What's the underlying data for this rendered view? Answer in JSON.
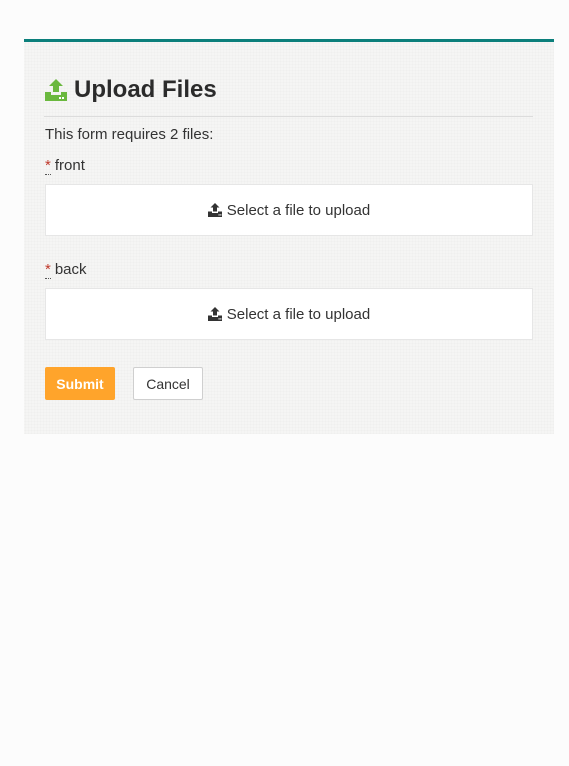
{
  "header": {
    "title": "Upload Files",
    "icon": "upload-icon",
    "icon_color": "#6ab83e"
  },
  "form": {
    "intro": "This form requires 2 files:",
    "required_marker": "*",
    "fields": [
      {
        "label": "front",
        "dropzone_text": "Select a file to upload",
        "icon": "upload-icon"
      },
      {
        "label": "back",
        "dropzone_text": "Select a file to upload",
        "icon": "upload-icon"
      }
    ]
  },
  "actions": {
    "submit_label": "Submit",
    "cancel_label": "Cancel",
    "submit_color": "#ffa42b"
  },
  "theme": {
    "accent": "#0b7f7b"
  }
}
